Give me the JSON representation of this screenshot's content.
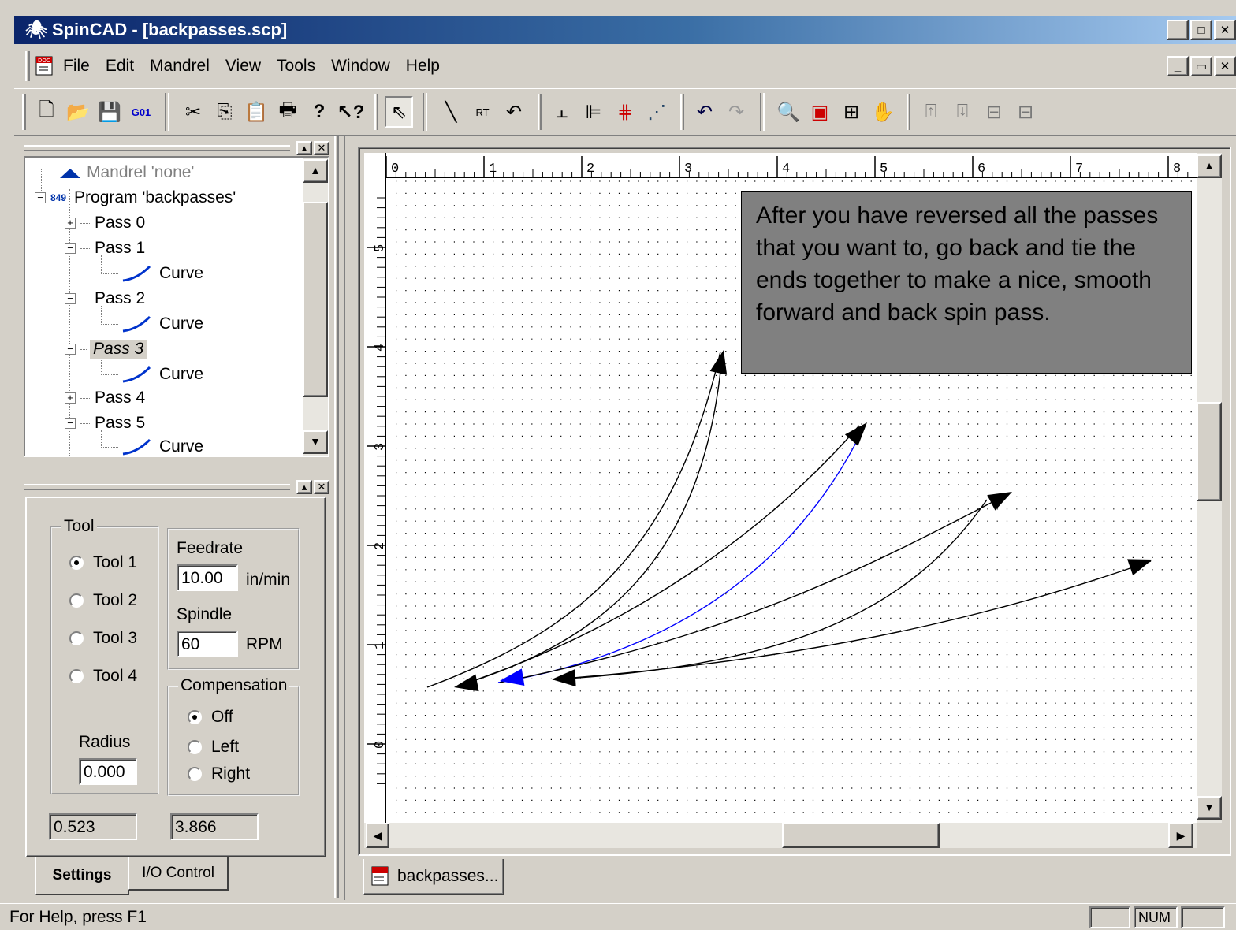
{
  "window": {
    "title": "SpinCAD - [backpasses.scp]",
    "controls": [
      "_",
      "□",
      "×"
    ],
    "mdi_controls": [
      "_",
      "▭",
      "×"
    ]
  },
  "menu": [
    "File",
    "Edit",
    "Mandrel",
    "View",
    "Tools",
    "Window",
    "Help"
  ],
  "toolbar": {
    "groups": [
      [
        "new-icon",
        "open-icon",
        "save-icon",
        "g01-icon",
        "cut-icon",
        "copy-icon",
        "paste-icon",
        "print-icon",
        "help-icon",
        "context-help-icon"
      ],
      [
        "select-arrow-icon",
        "line-icon",
        "rt-icon",
        "curve-icon"
      ],
      [
        "align-bottom-icon",
        "align-left-icon",
        "align-center-icon",
        "fan-icon"
      ],
      [
        "undo-icon",
        "redo-icon",
        "zoom-icon",
        "zoom-window-icon",
        "zoom-fit-icon",
        "pan-hand-icon"
      ],
      [
        "move-up-icon",
        "move-down-icon",
        "expand-h-icon",
        "collapse-h-icon"
      ]
    ],
    "g01_label": "G01",
    "rt_label": "RT"
  },
  "tree": {
    "items": [
      {
        "label": "Mandrel 'none'",
        "level": 0,
        "icon": "mandrel-icon",
        "grey": true
      },
      {
        "label": "Program 'backpasses'",
        "level": 0,
        "icon": "program-icon",
        "expander": "−"
      },
      {
        "label": "Pass 0",
        "level": 1,
        "expander": "+"
      },
      {
        "label": "Pass 1",
        "level": 1,
        "expander": "−"
      },
      {
        "label": "Curve",
        "level": 2,
        "icon": "curve-icon"
      },
      {
        "label": "Pass 2",
        "level": 1,
        "expander": "−"
      },
      {
        "label": "Curve",
        "level": 2,
        "icon": "curve-icon"
      },
      {
        "label": "Pass 3",
        "level": 1,
        "expander": "−",
        "selected": true
      },
      {
        "label": "Curve",
        "level": 2,
        "icon": "curve-icon"
      },
      {
        "label": "Pass 4",
        "level": 1,
        "expander": "+"
      },
      {
        "label": "Pass 5",
        "level": 1,
        "expander": "−"
      },
      {
        "label": "Curve",
        "level": 2,
        "icon": "curve-icon"
      }
    ]
  },
  "settings": {
    "tool_group": "Tool",
    "tools": [
      "Tool 1",
      "Tool 2",
      "Tool 3",
      "Tool 4"
    ],
    "tool_selected": 0,
    "radius_label": "Radius",
    "radius_value": "0.000",
    "feedrate_label": "Feedrate",
    "feedrate_value": "10.00",
    "feedrate_unit": "in/min",
    "spindle_label": "Spindle",
    "spindle_value": "60",
    "spindle_unit": "RPM",
    "compensation_group": "Compensation",
    "compensation": [
      "Off",
      "Left",
      "Right"
    ],
    "compensation_selected": 0,
    "coord_x": "0.523",
    "coord_y": "3.866"
  },
  "tabs": [
    "Settings",
    "I/O Control"
  ],
  "doc_tab": "backpasses...",
  "ruler": {
    "top_labels": [
      "0",
      "1",
      "2",
      "3",
      "4",
      "5",
      "6",
      "7",
      "8"
    ],
    "left_labels": [
      "5",
      "4",
      "3",
      "2",
      "1",
      "0"
    ]
  },
  "note": "After you have reversed all the passes that you want to, go back and tie the ends together to make a nice, smooth forward and back spin pass.",
  "status": {
    "help": "For Help, press F1",
    "num": "NUM"
  },
  "colors": {
    "title_start": "#0a246a",
    "title_end": "#a6caf0",
    "selected_curve": "#0000ff",
    "curve": "#000000",
    "note_bg": "#808080"
  }
}
